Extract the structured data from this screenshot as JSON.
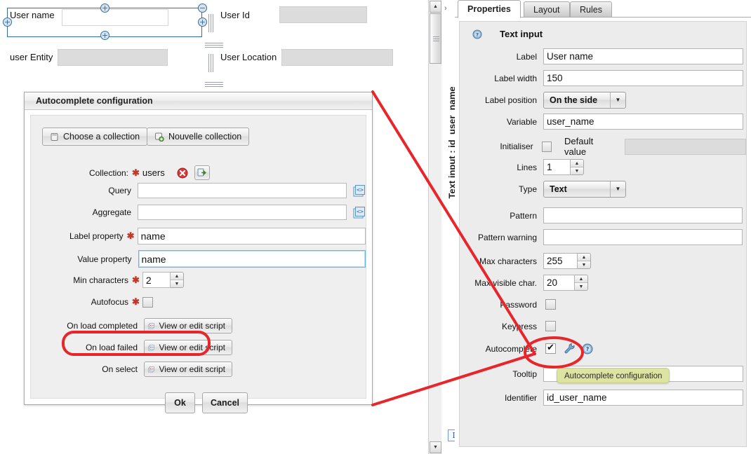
{
  "designer": {
    "fields": [
      {
        "label": "User name",
        "selected": true
      },
      {
        "label": "User Id"
      },
      {
        "label": "user Entity"
      },
      {
        "label": "User Location"
      }
    ],
    "handles": {
      "add": "+",
      "remove": "−"
    }
  },
  "dialog": {
    "title": "Autocomplete configuration",
    "buttons": {
      "choose_collection": "Choose a collection",
      "new_collection": "Nouvelle collection",
      "ok": "Ok",
      "cancel": "Cancel",
      "view_edit_script": "View or edit script"
    },
    "fields": {
      "collection_label": "Collection:",
      "collection_value": "users",
      "query_label": "Query",
      "query_value": "",
      "aggregate_label": "Aggregate",
      "aggregate_value": "",
      "label_property_label": "Label property",
      "label_property_value": "name",
      "value_property_label": "Value property",
      "value_property_value": "name",
      "min_characters_label": "Min characters",
      "min_characters_value": "2",
      "autofocus_label": "Autofocus",
      "autofocus_checked": false,
      "on_load_completed_label": "On load completed",
      "on_load_failed_label": "On load failed",
      "on_select_label": "On select"
    },
    "required_marker": "✱"
  },
  "sidetab": {
    "text": "Text input : id_user_name",
    "chevron": "›"
  },
  "scrollbar": {
    "up": "▲",
    "down": "▼"
  },
  "rightpanel": {
    "tabs": [
      {
        "label": "Properties",
        "active": true
      },
      {
        "label": "Layout",
        "active": false
      },
      {
        "label": "Rules",
        "active": false
      }
    ],
    "section_title": "Text input",
    "rows": {
      "label": {
        "label": "Label",
        "value": "User name"
      },
      "label_width": {
        "label": "Label width",
        "value": "150"
      },
      "label_position": {
        "label": "Label position",
        "value": "On the side"
      },
      "variable": {
        "label": "Variable",
        "value": "user_name"
      },
      "initialiser": {
        "label": "Initialiser",
        "checked": false,
        "default_value_label": "Default value",
        "default_value": ""
      },
      "lines": {
        "label": "Lines",
        "value": "1"
      },
      "type": {
        "label": "Type",
        "value": "Text"
      },
      "pattern": {
        "label": "Pattern",
        "value": ""
      },
      "pattern_warning": {
        "label": "Pattern warning",
        "value": ""
      },
      "max_characters": {
        "label": "Max characters",
        "value": "255"
      },
      "max_visible_char": {
        "label": "Max visible char.",
        "value": "20"
      },
      "password": {
        "label": "Password",
        "checked": false
      },
      "keypress": {
        "label": "Keypress",
        "checked": false
      },
      "autocomplete": {
        "label": "Autocomplete",
        "checked": true
      },
      "tooltip": {
        "label": "Tooltip",
        "value": ""
      },
      "identifier": {
        "label": "Identifier",
        "value": "id_user_name"
      }
    },
    "select_arrow": "▼"
  },
  "tooltip": {
    "text": "Autocomplete configuration"
  },
  "caret_icon": {
    "glyph": "I"
  },
  "colors": {
    "annotation": "#e8252a",
    "tooltip_bg": "#dde3a0",
    "selection": "#2f6fa6",
    "required": "#c0392b"
  }
}
